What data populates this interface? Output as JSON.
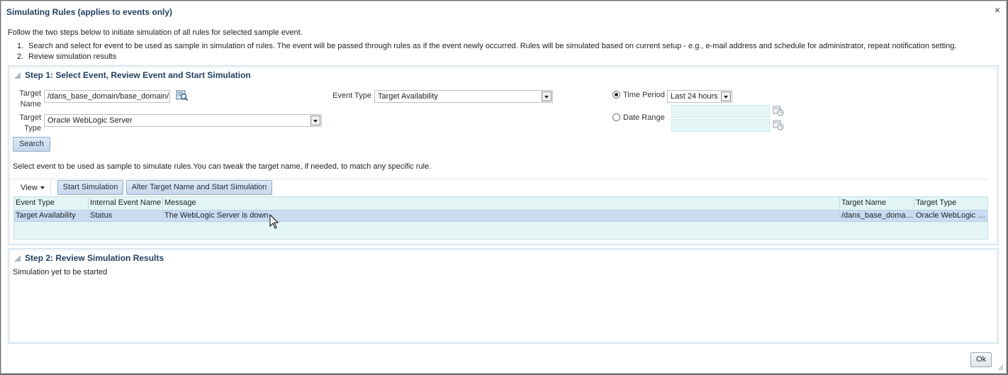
{
  "dialog": {
    "title": "Simulating Rules (applies to events only)",
    "close_glyph": "×",
    "intro": "Follow the two steps below to initiate simulation of all rules for selected sample event.",
    "steps": [
      {
        "num": "1.",
        "text": "Search and select for event to be used as sample in simulation of rules. The event will be passed through rules as if the event newly occurred. Rules will be simulated based on current setup - e.g., e-mail address and schedule for administrator, repeat notification setting."
      },
      {
        "num": "2.",
        "text": "Review simulation results"
      }
    ],
    "ok_label": "Ok"
  },
  "step1": {
    "header": "Step 1: Select Event, Review Event and Start Simulation",
    "target_name_label": "Target\nName",
    "target_name_value": "/dans_base_domain/base_domain/l",
    "target_type_label": "Target\nType",
    "target_type_value": "Oracle WebLogic Server",
    "event_type_label": "Event Type",
    "event_type_value": "Target Availability",
    "time_period_label": "Time Period",
    "time_period_value": "Last 24 hours",
    "time_period_selected": true,
    "date_range_label": "Date Range",
    "search_label": "Search",
    "hint": "Select event to be used as sample to simulate rules.You can tweak the target name, if needed, to match any specific rule.",
    "view_label": "View",
    "start_simulation_label": "Start Simulation",
    "alter_start_label": "Alter Target Name and Start Simulation",
    "columns": [
      "Event Type",
      "Internal Event Name",
      "Message",
      "Target Name",
      "Target Type"
    ],
    "rows": [
      [
        "Target Availability",
        "Status",
        "The WebLogic Server is down",
        "/dans_base_domai...",
        "Oracle WebLogic S..."
      ]
    ]
  },
  "step2": {
    "header": "Step 2: Review Simulation Results",
    "status": "Simulation yet to be started"
  },
  "colors": {
    "title": "#1f3f5f",
    "grid_bg": "#e3f6f5",
    "selected_row": "#c9ddf2",
    "button_bg": "#c4d7ea"
  },
  "icons": {
    "search_lookup": "search-lookup-icon",
    "calendar": "calendar-icon",
    "panel_toggle": "disclosure-triangle-icon"
  }
}
